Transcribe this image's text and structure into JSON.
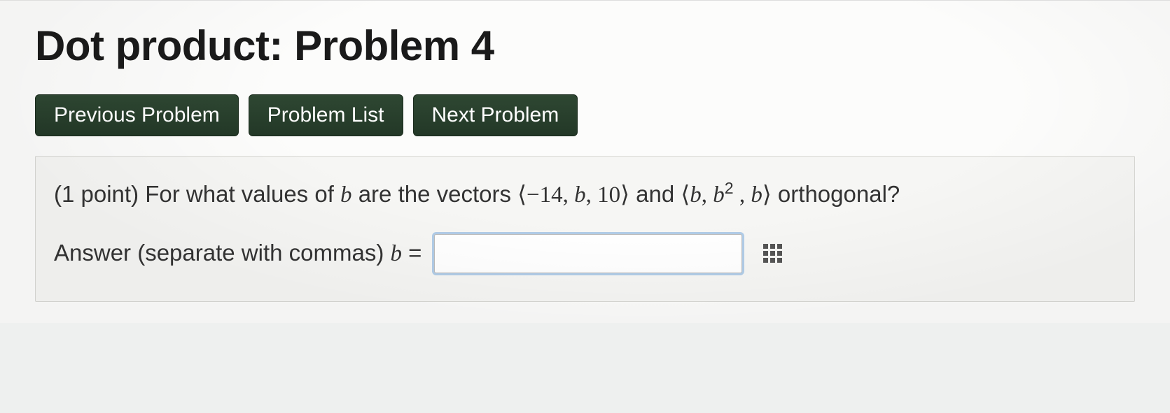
{
  "title": "Dot product: Problem 4",
  "nav": {
    "prev": "Previous Problem",
    "list": "Problem List",
    "next": "Next Problem"
  },
  "question": {
    "points_prefix": "(1 point) ",
    "lead": "For what values of ",
    "var": "b",
    "mid": " are the vectors ",
    "vec1_open": "⟨−14, ",
    "vec1_b": "b",
    "vec1_close": ", 10⟩",
    "and": " and ",
    "vec2_open": "⟨",
    "vec2_b1": "b",
    "vec2_comma1": ", ",
    "vec2_b2": "b",
    "vec2_exp": "2",
    "vec2_comma2": " , ",
    "vec2_b3": "b",
    "vec2_close": "⟩",
    "tail": " orthogonal?"
  },
  "answer": {
    "label_pre": "Answer (separate with commas) ",
    "var": "b",
    "eq": " = ",
    "value": ""
  }
}
